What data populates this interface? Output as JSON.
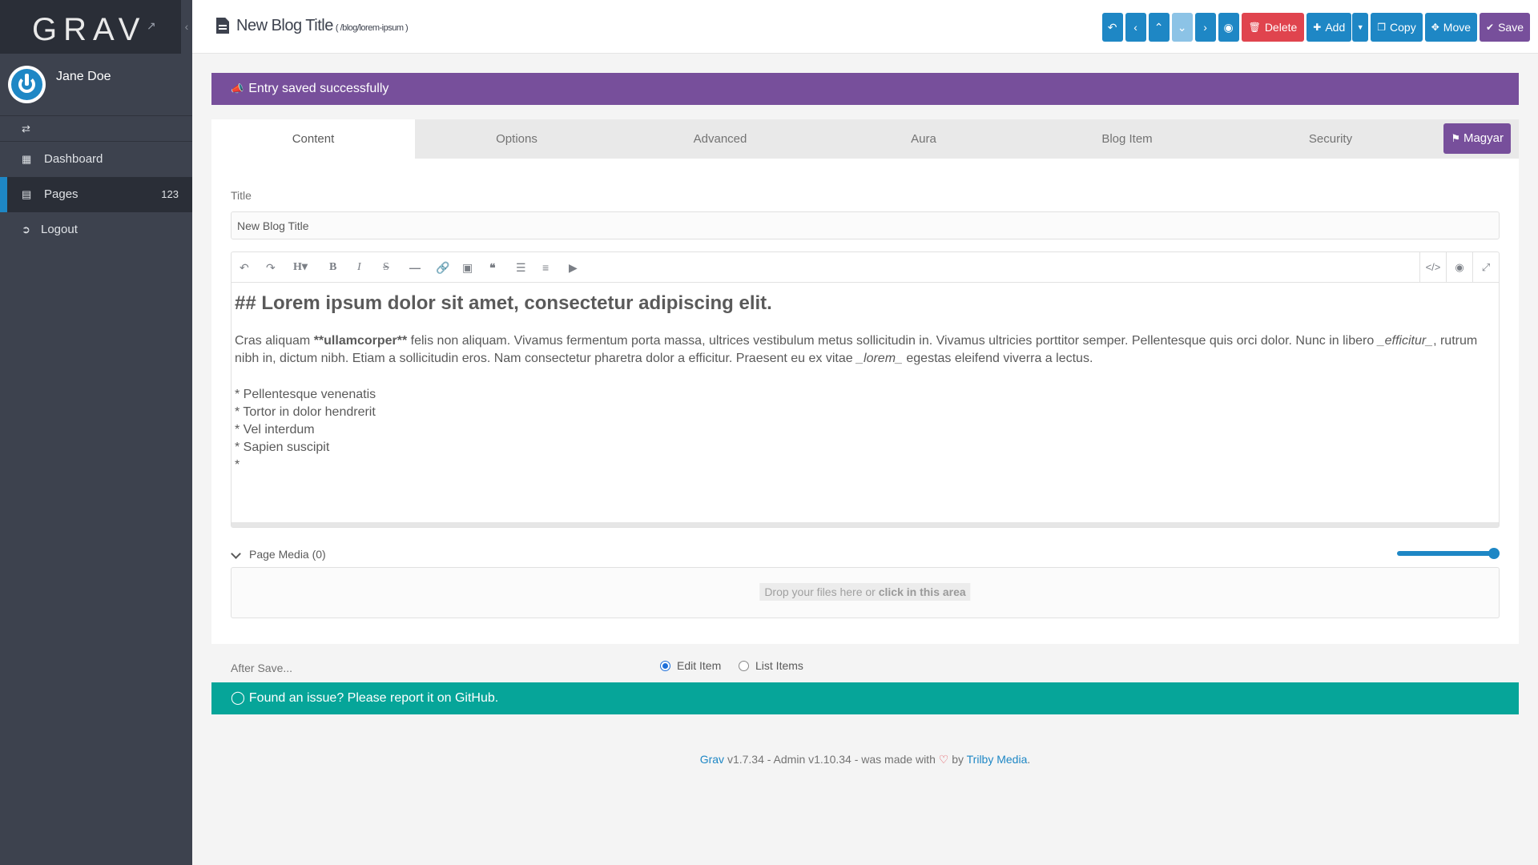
{
  "sidebar": {
    "logo": "GRAV",
    "user_name": "Jane Doe",
    "items": [
      {
        "label": "Dashboard",
        "icon": "dashboard-icon"
      },
      {
        "label": "Pages",
        "badge": "123",
        "icon": "page-icon"
      },
      {
        "label": "Logout",
        "icon": "logout-icon"
      }
    ]
  },
  "header": {
    "title": "New Blog Title",
    "route": "( /blog/lorem-ipsum )",
    "buttons": {
      "delete": "Delete",
      "add": "Add",
      "copy": "Copy",
      "move": "Move",
      "save": "Save"
    }
  },
  "alert": "Entry saved successfully",
  "tabs": [
    "Content",
    "Options",
    "Advanced",
    "Aura",
    "Blog Item",
    "Security"
  ],
  "language_button": "Magyar",
  "form": {
    "title_label": "Title",
    "title_value": "New Blog Title",
    "editor": {
      "heading": "## Lorem ipsum dolor sit amet, consectetur adipiscing elit.",
      "para_before_bold": "Cras aliquam ",
      "para_bold": "**ullamcorper**",
      "para_mid1": " felis non aliquam. Vivamus fermentum porta massa, ultrices vestibulum metus sollicitudin in. Vivamus ultricies porttitor semper. Pellentesque quis orci dolor. Nunc in libero ",
      "para_italic1": "_efficitur_",
      "para_mid2": ", rutrum nibh in, dictum nibh. Etiam a sollicitudin eros. Nam consectetur pharetra dolor a efficitur. Praesent eu ex vitae ",
      "para_italic2": "_lorem_",
      "para_end": " egestas eleifend viverra a lectus.",
      "list": [
        "* Pellentesque venenatis",
        "* Tortor in dolor hendrerit",
        "* Vel interdum",
        "* Sapien suscipit",
        "*"
      ]
    },
    "media_label": "Page Media (0)",
    "media_slider_value": 1.0,
    "dropzone_text": "Drop your files here or ",
    "dropzone_bold": "click in this area",
    "after_save_label": "After Save...",
    "after_save_options": [
      "Edit Item",
      "List Items"
    ],
    "after_save_selected": "Edit Item"
  },
  "issue_bar": "Found an issue? Please report it on GitHub.",
  "footer": {
    "grav": "Grav",
    "text1": " v1.7.34 - Admin v1.10.34 - was made with ",
    "text2": " by ",
    "trilby": "Trilby Media",
    "text3": "."
  },
  "colors": {
    "sidebar": "#3d424e",
    "accent_blue": "#1e87c5",
    "purple": "#774f9b",
    "red": "#e0444e",
    "teal": "#06a599"
  }
}
